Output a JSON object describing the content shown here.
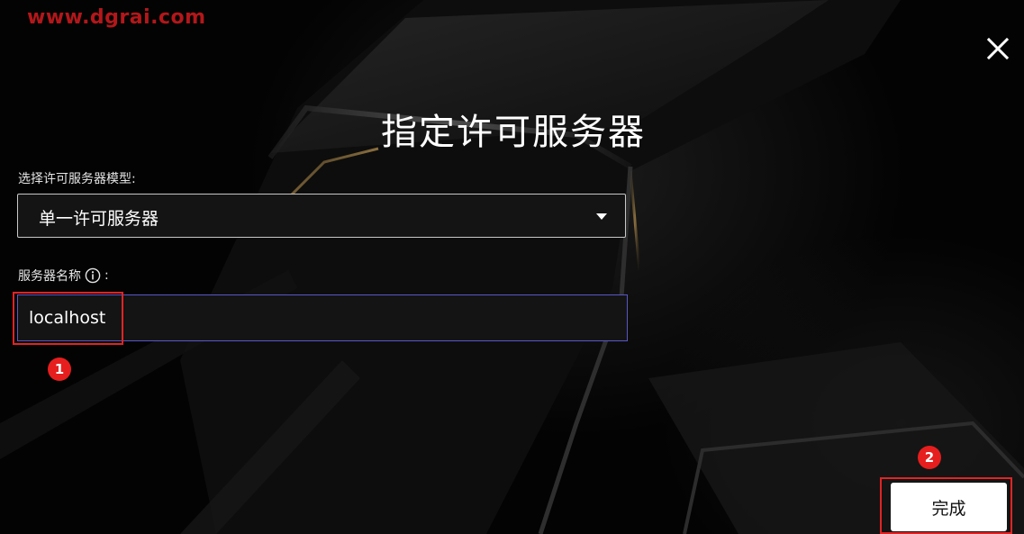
{
  "watermark": "www.dgrai.com",
  "dialog": {
    "title": "指定许可服务器"
  },
  "license_model": {
    "label": "选择许可服务器模型:",
    "selected": "单一许可服务器"
  },
  "server_name": {
    "label": "服务器名称",
    "label_suffix": ":",
    "value": "localhost"
  },
  "annotations": {
    "step_1": "1",
    "step_2": "2",
    "highlight_color": "#e02424"
  },
  "buttons": {
    "done_label": "完成"
  },
  "icons": {
    "close": "close-icon",
    "info": "info-icon",
    "dropdown": "caret-down-icon"
  },
  "colors": {
    "background": "#030303",
    "input_focus_border": "#5a56c8",
    "badge": "#e61e1e"
  }
}
